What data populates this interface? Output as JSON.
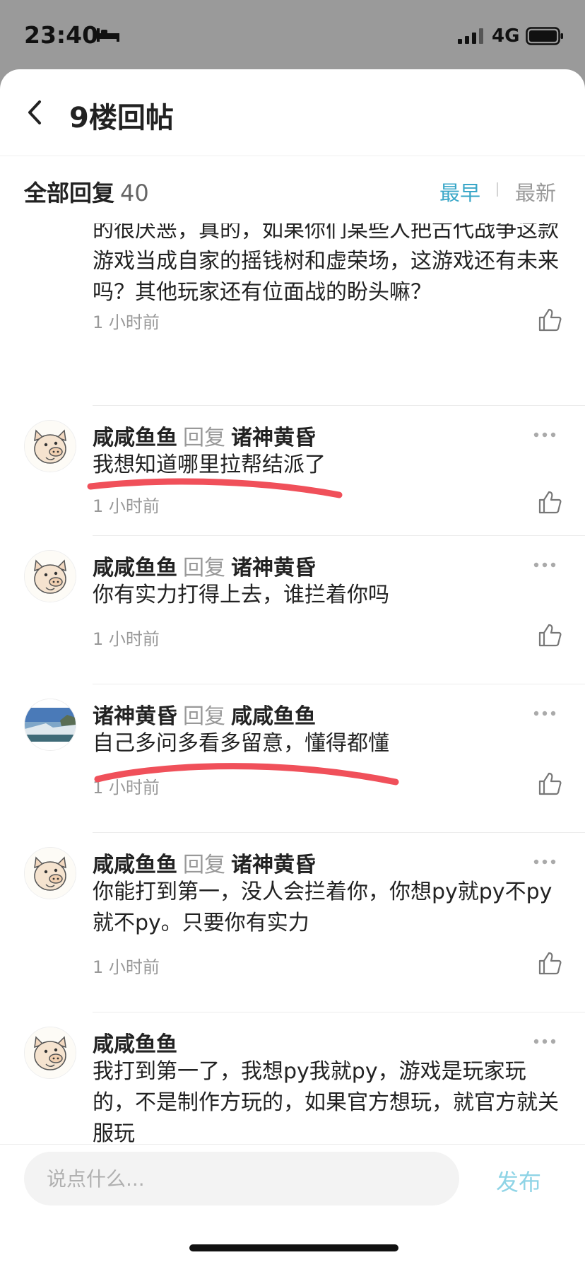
{
  "status_bar": {
    "time": "23:40",
    "network": "4G"
  },
  "header": {
    "title": "9楼回帖"
  },
  "replies_header": {
    "label": "全部回复",
    "count": "40",
    "sort_earliest": "最早",
    "sort_latest": "最新",
    "active_sort": "最早"
  },
  "reply_word": "回复",
  "comments": [
    {
      "author": "",
      "target": "",
      "avatar": "",
      "text": "的很厌恶，真的，如果你们某些人把古代战争这款游戏当成自家的摇钱树和虚荣场，这游戏还有未来吗？其他玩家还有位面战的盼头嘛？",
      "time": "1 小时前"
    },
    {
      "author": "咸咸鱼鱼",
      "target": "诸神黄昏",
      "avatar": "pig-avatar",
      "text": "我想知道哪里拉帮结派了",
      "time": "1 小时前",
      "annotated": true
    },
    {
      "author": "咸咸鱼鱼",
      "target": "诸神黄昏",
      "avatar": "pig-avatar",
      "text": "你有实力打得上去，谁拦着你吗",
      "time": "1 小时前"
    },
    {
      "author": "诸神黄昏",
      "target": "咸咸鱼鱼",
      "avatar": "waterfall-avatar",
      "text": "自己多问多看多留意，懂得都懂",
      "time": "1 小时前",
      "annotated": true
    },
    {
      "author": "咸咸鱼鱼",
      "target": "诸神黄昏",
      "avatar": "pig-avatar",
      "text": "你能打到第一，没人会拦着你，你想py就py不py就不py。只要你有实力",
      "time": "1 小时前"
    },
    {
      "author": "咸咸鱼鱼",
      "target": "",
      "avatar": "pig-avatar",
      "text": "我打到第一了，我想py我就py，游戏是玩家玩的，不是制作方玩的，如果官方想玩，就官方就关服玩",
      "time": ""
    }
  ],
  "input": {
    "placeholder": "说点什么...",
    "value": ""
  },
  "publish_label": "发布",
  "colors": {
    "accent": "#3aa7c8",
    "annotation": "#f0505a",
    "publish": "#8fd4e6"
  }
}
